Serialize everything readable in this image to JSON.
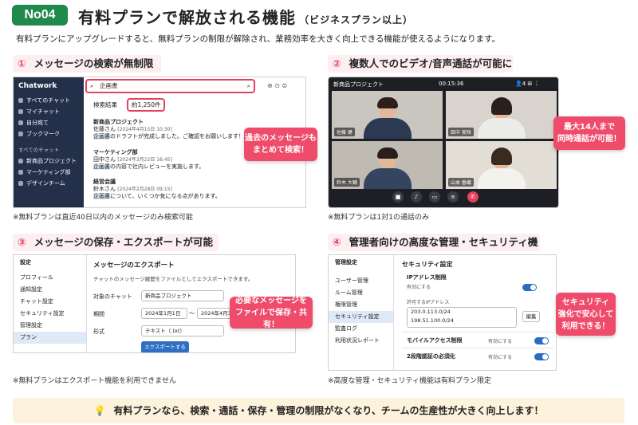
{
  "header": {
    "tag": "No04",
    "title": "有料プランで解放される機能",
    "subtitle": "（ビジネスプラン以上）",
    "intro": "有料プランにアップグレードすると、無料プランの制限が解除され、業務効率を大きく向上できる機能が使えるようになります。"
  },
  "s1": {
    "num": "①",
    "title": "メッセージの検索が無制限に",
    "note": "※無料プランは直近40日以内のメッセージのみ検索可能",
    "logo": "Chatwork",
    "side": [
      "すべてのチャット",
      "マイチャット",
      "自分宛て",
      "ブックマーク"
    ],
    "side_head": "すべてのチャット",
    "side2": [
      "新商品プロジェクト",
      "マーケティング部",
      "デザインチーム"
    ],
    "search": "企画書",
    "results_label": "検索結果",
    "results_count": "約1,250件",
    "results": [
      {
        "room": "新商品プロジェクト",
        "who": "佐藤さん",
        "date": "[2024年4月15日 10:30]",
        "pre": "",
        "hit": "企画書",
        "post": "のドラフトが完成しました。ご確認をお願いします！"
      },
      {
        "room": "マーケティング部",
        "who": "田中さん",
        "date": "[2024年3月22日 16:45]",
        "pre": "",
        "hit": "企画書",
        "post": "の内容で社内レビューを実施します。"
      },
      {
        "room": "経営会議",
        "who": "鈴木さん",
        "date": "[2024年2月28日 09:15]",
        "pre": "",
        "hit": "企画書",
        "post": "について、いくつか気になる点があります。"
      }
    ],
    "callout": "過去のメッセージも\nまとめて検索！"
  },
  "s2": {
    "num": "②",
    "title": "複数人でのビデオ/音声通話が可能に",
    "note": "※無料プランは1対1の通話のみ",
    "room": "新商品プロジェクト",
    "time": "00:15:36",
    "count": "4",
    "people": [
      "佐藤 健",
      "田中 美咲",
      "鈴木 大輔",
      "山本 香織"
    ],
    "callout": "最大14人まで\n同時通話が可能！"
  },
  "s3": {
    "num": "③",
    "title": "メッセージの保存・エクスポートが可能に",
    "note": "※無料プランはエクスポート機能を利用できません",
    "menu_head": "設定",
    "menu": [
      "プロフィール",
      "通知設定",
      "チャット設定",
      "セキュリティ設定",
      "管理設定",
      "プラン"
    ],
    "form_title": "メッセージのエクスポート",
    "form_desc": "チャットのメッセージ履歴をファイルとしてエクスポートできます。",
    "f_chat_label": "対象のチャット",
    "f_chat": "新商品プロジェクト",
    "f_period_label": "期間",
    "f_from": "2024年1月1日",
    "tilde": "～",
    "f_to": "2024年4月30日",
    "f_format_label": "形式",
    "f_format": "テキスト（.txt）",
    "button": "エクスポートする",
    "callout": "必要なメッセージを\nファイルで保存・共有！"
  },
  "s4": {
    "num": "④",
    "title": "管理者向けの高度な管理・セキュリティ機能",
    "note": "※高度な管理・セキュリティ機能は有料プラン限定",
    "menu_head": "管理設定",
    "menu": [
      "ユーザー管理",
      "ルーム管理",
      "権限管理",
      "セキュリティ設定",
      "監査ログ",
      "利用状況レポート"
    ],
    "panel_title": "セキュリティ設定",
    "ip_title": "IPアドレス制限",
    "ip_enable": "有効にする",
    "ip_allowed": "許可するIPアドレス",
    "ips": [
      "203.0.113.0/24",
      "198.51.100.0/24"
    ],
    "edit": "編集",
    "mobile": "モバイルアクセス制限",
    "mobile_state": "有効にする",
    "twofa": "2段階認証の必須化",
    "twofa_state": "有効にする",
    "callout": "セキュリティ\n強化で安心して\n利用できる！"
  },
  "footer": "有料プランなら、検索・通話・保存・管理の制限がなくなり、チームの生産性が大きく向上します！"
}
